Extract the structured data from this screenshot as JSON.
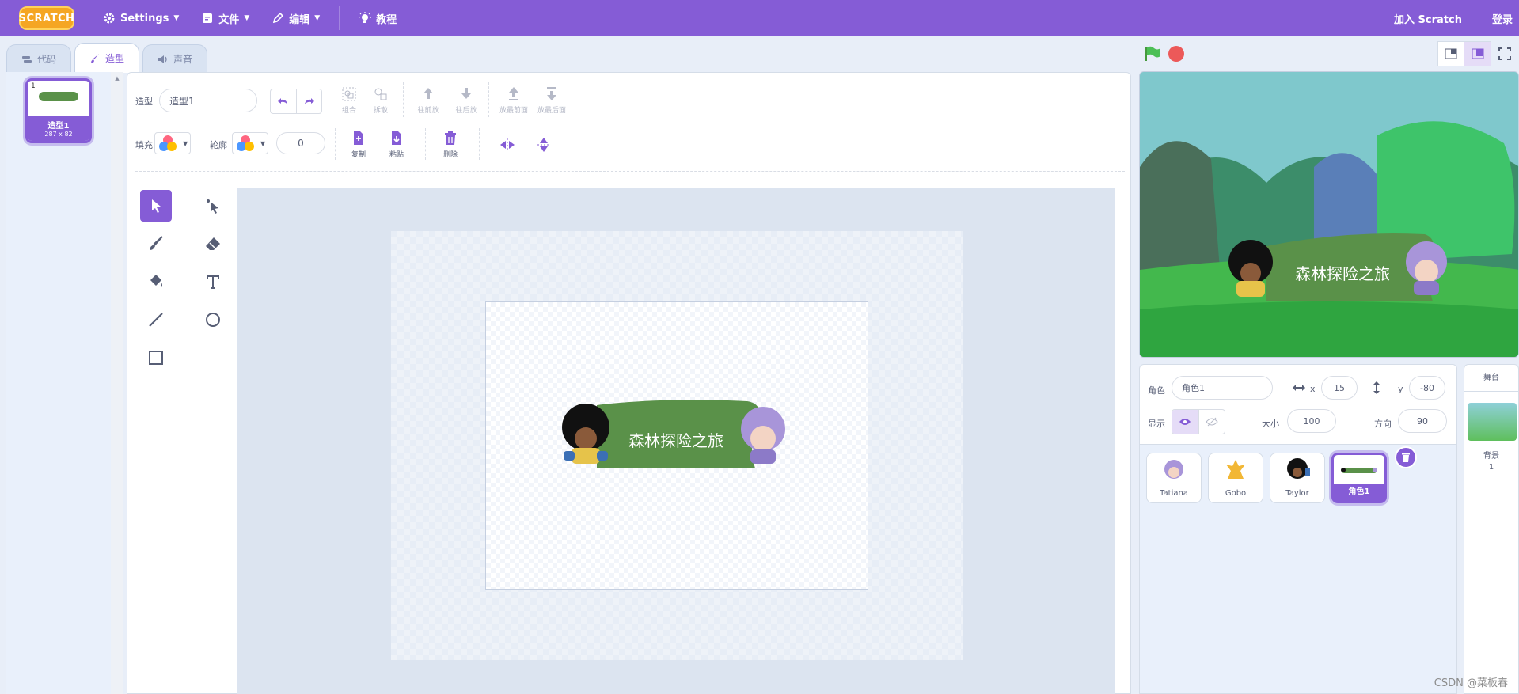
{
  "menubar": {
    "logo": "SCRATCH",
    "settings": "Settings",
    "file": "文件",
    "edit": "编辑",
    "tutorials": "教程",
    "join": "加入 Scratch",
    "signin": "登录"
  },
  "tabs": [
    {
      "label": "代码"
    },
    {
      "label": "造型"
    },
    {
      "label": "声音"
    }
  ],
  "costume": {
    "number": "1",
    "name": "造型1",
    "size": "287 x 82"
  },
  "paint": {
    "name_label": "造型",
    "name_value": "造型1",
    "group": "组合",
    "ungroup": "拆散",
    "forward": "往前放",
    "backward": "往后放",
    "front": "放最前面",
    "back": "放最后面",
    "fill_label": "填充",
    "outline_label": "轮廓",
    "outline_width": "0",
    "copy": "复制",
    "paste": "粘贴",
    "delete": "删除",
    "banner_text": "森林探险之旅"
  },
  "stage": {
    "banner_text": "森林探险之旅"
  },
  "sprite_info": {
    "sprite_label": "角色",
    "sprite_name": "角色1",
    "x_label": "x",
    "x_value": "15",
    "y_label": "y",
    "y_value": "-80",
    "show_label": "显示",
    "size_label": "大小",
    "size_value": "100",
    "direction_label": "方向",
    "direction_value": "90"
  },
  "sprites": [
    {
      "name": "Tatiana"
    },
    {
      "name": "Gobo"
    },
    {
      "name": "Taylor"
    },
    {
      "name": "角色1"
    }
  ],
  "stage_target": {
    "header": "舞台",
    "backdrop_label": "背景",
    "backdrop_count": "1"
  },
  "watermark": "CSDN @菜板春",
  "colors": {
    "accent": "#855cd6",
    "banner_green": "#5a9149"
  }
}
